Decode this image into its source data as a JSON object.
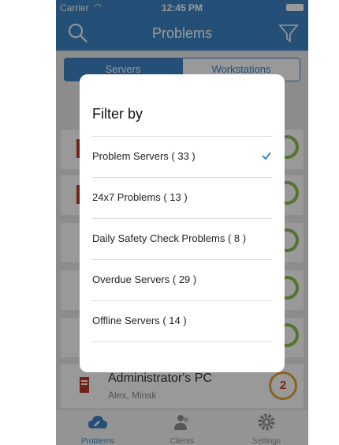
{
  "status_bar": {
    "carrier": "Carrier",
    "time": "12:45 PM"
  },
  "navbar": {
    "title": "Problems"
  },
  "segments": {
    "servers": "Servers",
    "workstations": "Workstations"
  },
  "admin_row": {
    "name": "Administrator's PC",
    "location": "Alex, Minsk",
    "count": "2"
  },
  "tabs": [
    {
      "label": "Problems",
      "icon": "wrench-cloud-icon"
    },
    {
      "label": "Clients",
      "icon": "people-icon"
    },
    {
      "label": "Settings",
      "icon": "gear-icon"
    }
  ],
  "filter_sheet": {
    "heading": "Filter by",
    "options": [
      {
        "label": "Problem Servers ( 33 )",
        "selected": true
      },
      {
        "label": "24x7 Problems ( 13 )",
        "selected": false
      },
      {
        "label": "Daily Safety Check Problems ( 8 )",
        "selected": false
      },
      {
        "label": "Overdue Servers ( 29 )",
        "selected": false
      },
      {
        "label": "Offline Servers ( 14 )",
        "selected": false
      }
    ]
  },
  "colors": {
    "accent": "#3c86c8",
    "ring_green": "#8dc24b",
    "ring_orange": "#e7a335",
    "badge_red": "#d23a2a"
  }
}
